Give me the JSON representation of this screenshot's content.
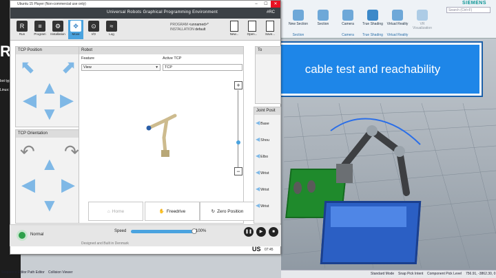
{
  "left_window": {
    "title_fragment": "Universal Robots",
    "big_text": "RS",
    "lines": [
      "bot typ",
      "Linux: e"
    ]
  },
  "ursim": {
    "window_title": "Ubuntu 15 Player (Non-commercial use only)",
    "app_title": "Universal Robots Graphical Programming Environment",
    "header_right": "#RC",
    "toolbar": [
      {
        "label": "Run",
        "icon": "R"
      },
      {
        "label": "Program",
        "icon": "≡"
      },
      {
        "label": "Installation",
        "icon": "⚙"
      },
      {
        "label": "Move",
        "icon": "✥"
      },
      {
        "label": "I/O",
        "icon": "⊙"
      },
      {
        "label": "Log",
        "icon": "≈"
      }
    ],
    "program_label": "PROGRAM",
    "program_value": "<unnamed>*",
    "installation_label": "INSTALLATION",
    "installation_value": "default",
    "file_buttons": [
      {
        "label": "New..."
      },
      {
        "label": "Open..."
      },
      {
        "label": "Save..."
      }
    ],
    "tcp_position_title": "TCP Position",
    "tcp_orientation_title": "TCP Orientation",
    "robot_title": "Robot",
    "feature_label": "Feature",
    "feature_value": "View",
    "active_tcp_label": "Active TCP",
    "active_tcp_value": "TCP",
    "zoom_in": "+",
    "zoom_out": "−",
    "home_button": "Home",
    "freedrive_button": "Freedrive",
    "zero_position_button": "Zero Position",
    "tool_panel_title": "To",
    "joint_title": "Joint Posit",
    "joints": [
      "Base",
      "Shou",
      "Elbo",
      "Wrist",
      "Wrist",
      "Wrist"
    ],
    "status": "Normal",
    "speed_label": "Speed",
    "speed_value": "100%",
    "speed_fraction": 1.0,
    "built_text": "Designed and Built in Denmark",
    "keyboard": "US",
    "clock": "07:45"
  },
  "simulator": {
    "brand": "SIEMENS",
    "search_placeholder": "Search (Ctrl+F)",
    "ribbon": [
      {
        "label": "New Section",
        "group": "Section"
      },
      {
        "label": "Section",
        "group": "Section"
      },
      {
        "label": "Camera",
        "group": "Camera"
      },
      {
        "label": "True Shading",
        "group": "True Shading"
      },
      {
        "label": "Virtual Reality",
        "group": "Virtual Reality"
      },
      {
        "label": "VR Visualization",
        "group": "Virtual Reality"
      }
    ],
    "callout": "cable test and reachability",
    "status": [
      "Standard Mode",
      "Snap Pick Intent",
      "Component Pick Level",
      "756.91, -3862.30, 0"
    ],
    "bottom_tabs": [
      "Sequence Editor",
      "Path Editor",
      "Collision Viewer"
    ]
  },
  "colors": {
    "accent": "#4aa3df",
    "callout": "#1e86e8",
    "status_ok": "#2da04a",
    "green_box": "#1f8a2c",
    "blue_box": "#2b5fc4"
  }
}
